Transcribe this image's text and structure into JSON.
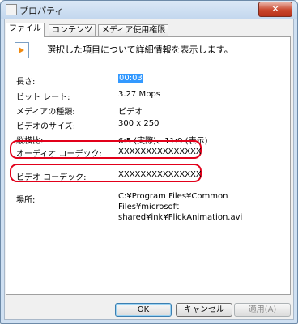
{
  "window": {
    "title": "プロパティ",
    "close_label": "✕"
  },
  "tabs": [
    {
      "label": "ファイル",
      "active": true
    },
    {
      "label": "コンテンツ",
      "active": false
    },
    {
      "label": "メディア使用権限",
      "active": false
    }
  ],
  "description": "選択した項目について詳細情報を表示します。",
  "properties": [
    {
      "label": "長さ:",
      "value": "00:03"
    },
    {
      "label": "ビット レート:",
      "value": "3.27 Mbps"
    },
    {
      "label": "メディアの種類:",
      "value": "ビデオ"
    },
    {
      "label": "ビデオのサイズ:",
      "value": "300 x 250"
    },
    {
      "label": "縦横比:",
      "value": "6:5 (実際)、11:9 (表示)"
    },
    {
      "label": "オーディオ コーデック:",
      "value": "XXXXXXXXXXXXXXX"
    },
    {
      "label": "ビデオ コーデック:",
      "value": "XXXXXXXXXXXXXXX"
    },
    {
      "label": "場所:",
      "value": "C:¥Program Files¥Common Files¥microsoft shared¥ink¥FlickAnimation.avi"
    }
  ],
  "buttons": {
    "ok": "OK",
    "cancel": "キャンセル",
    "apply": "適用(A)"
  },
  "colors": {
    "highlight": "#e2001a",
    "selection": "#3399ff"
  }
}
